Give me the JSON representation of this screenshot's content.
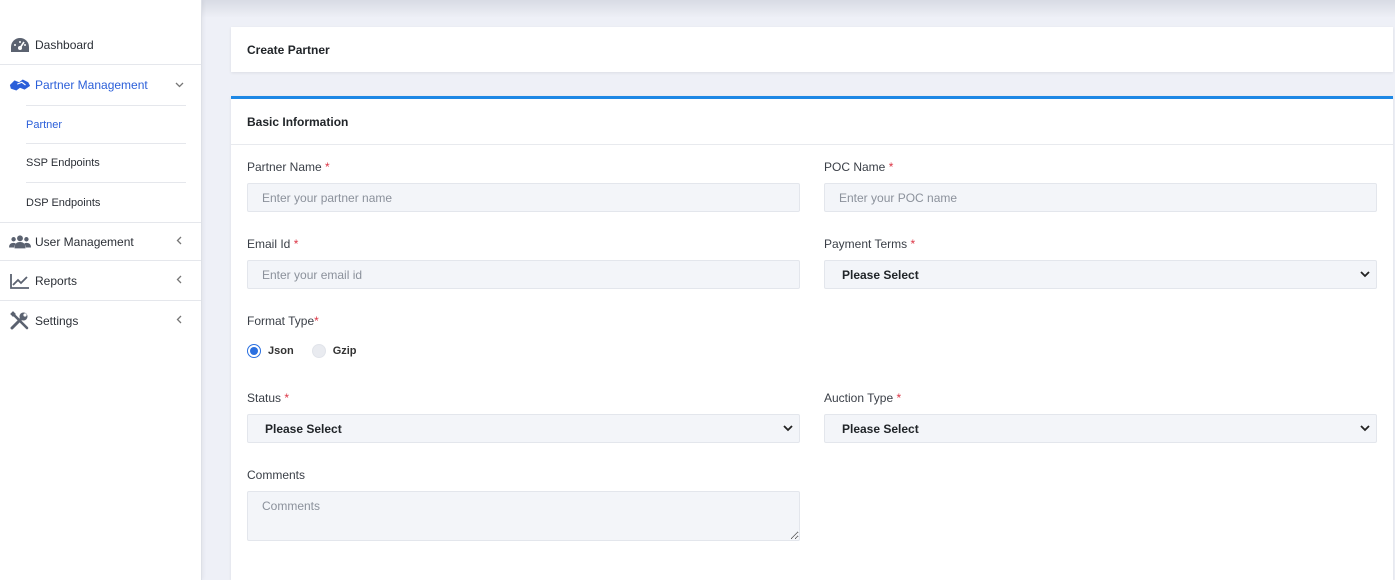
{
  "sidebar": {
    "items": [
      {
        "label": "Dashboard",
        "icon": "dashboard-gauge-icon",
        "expanded": null
      },
      {
        "label": "Partner Management",
        "icon": "handshake-icon",
        "expanded": true,
        "active": true
      },
      {
        "label": "User Management",
        "icon": "users-icon",
        "expanded": false
      },
      {
        "label": "Reports",
        "icon": "line-chart-icon",
        "expanded": false
      },
      {
        "label": "Settings",
        "icon": "tools-icon",
        "expanded": false
      }
    ],
    "sub_items": [
      {
        "label": "Partner",
        "active": true
      },
      {
        "label": "SSP Endpoints",
        "active": false
      },
      {
        "label": "DSP Endpoints",
        "active": false
      }
    ]
  },
  "page": {
    "title": "Create Partner"
  },
  "form": {
    "section_title": "Basic Information",
    "required_mark": "*",
    "partner_name": {
      "label": "Partner Name",
      "placeholder": "Enter your partner name",
      "value": ""
    },
    "poc_name": {
      "label": "POC Name",
      "placeholder": "Enter your POC name",
      "value": ""
    },
    "email": {
      "label": "Email Id",
      "placeholder": "Enter your email id",
      "value": ""
    },
    "payment_terms": {
      "label": "Payment Terms",
      "selected": "Please Select"
    },
    "format_type": {
      "label": "Format Type",
      "options": [
        {
          "label": "Json",
          "checked": true
        },
        {
          "label": "Gzip",
          "checked": false
        }
      ]
    },
    "status": {
      "label": "Status",
      "selected": "Please Select"
    },
    "auction_type": {
      "label": "Auction Type",
      "selected": "Please Select"
    },
    "comments": {
      "label": "Comments",
      "placeholder": "Comments",
      "value": ""
    }
  },
  "colors": {
    "accent": "#1e88e5",
    "active_link": "#2b5fd9",
    "required": "#dc3545"
  }
}
